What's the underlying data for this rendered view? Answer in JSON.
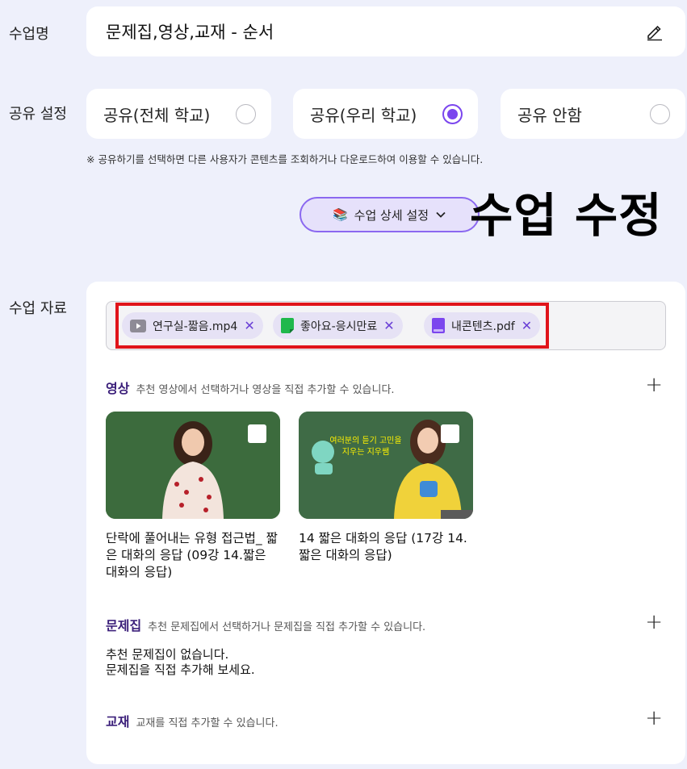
{
  "class_name": {
    "label": "수업명",
    "value": "문제집,영상,교재 - 순서"
  },
  "share": {
    "label": "공유 설정",
    "options": [
      {
        "label": "공유(전체 학교)",
        "checked": false
      },
      {
        "label": "공유(우리 학교)",
        "checked": true
      },
      {
        "label": "공유 안함",
        "checked": false
      }
    ],
    "notice": "※ 공유하기를 선택하면 다른 사용자가 콘텐츠를 조회하거나 다운로드하여 이용할 수 있습니다."
  },
  "detail_button": {
    "emoji": "📚",
    "label": "수업 상세 설정",
    "icon": "chevron-down-icon"
  },
  "overlay_title": "수업 수정",
  "materials": {
    "label": "수업 자료",
    "chips": [
      {
        "label": "연구실-짧음.mp4",
        "icon": "video-file-icon",
        "color": "#8e8b96"
      },
      {
        "label": "좋아요-응시만료",
        "icon": "note-file-icon",
        "color": "#1fb84c"
      },
      {
        "label": "내콘텐츠.pdf",
        "icon": "pdf-file-icon",
        "color": "#7b46ee"
      }
    ],
    "video_section": {
      "title": "영상",
      "description": "추천 영상에서 선택하거나 영상을 직접 추가할 수 있습니다.",
      "videos": [
        {
          "title": "단락에 풀어내는 유형 접근법_ 짧은 대화의 응답 (09강 14.짧은 대화의 응답)"
        },
        {
          "title": "14 짧은 대화의 응답 (17강 14. 짧은 대화의 응답)",
          "thumb_text": "여러분의 듣기 고민을 지우는 지우쌤"
        }
      ]
    },
    "workbook_section": {
      "title": "문제집",
      "description": "추천 문제집에서 선택하거나 문제집을 직접 추가할 수 있습니다.",
      "empty_line1": "추천 문제집이 없습니다.",
      "empty_line2": "문제집을 직접 추가해 보세요."
    },
    "textbook_section": {
      "title": "교재",
      "description": "교재를 직접 추가할 수 있습니다."
    }
  },
  "colors": {
    "accent": "#7b46ee",
    "background": "#eef0fb",
    "highlight_frame": "#e0141a"
  }
}
